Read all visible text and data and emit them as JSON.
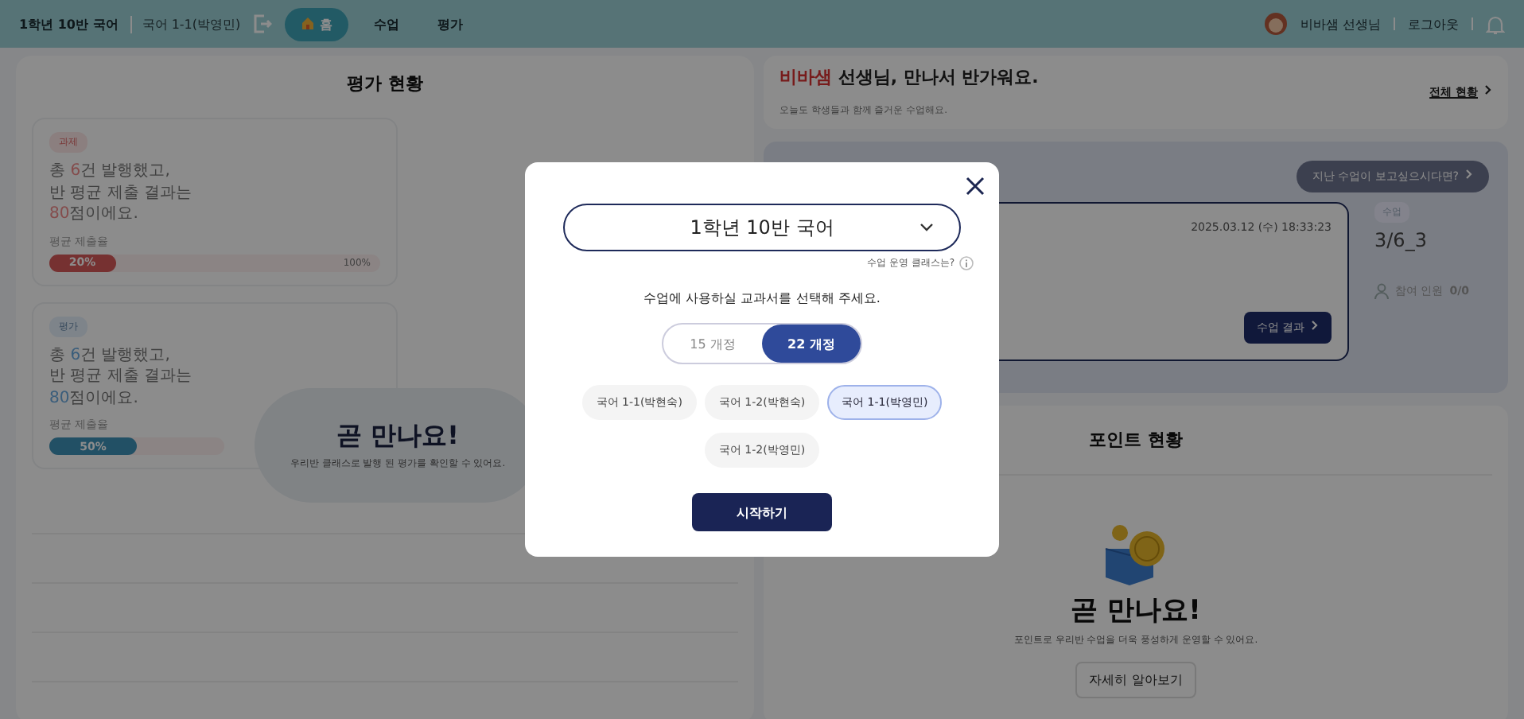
{
  "header": {
    "class_name": "1학년 10반 국어",
    "textbook": "국어 1-1(박영민)",
    "tabs": [
      {
        "label": "홈",
        "selected": true,
        "icon": true
      },
      {
        "label": "수업",
        "selected": false,
        "icon": false
      },
      {
        "label": "평가",
        "selected": false,
        "icon": false
      }
    ],
    "user": "비바샘 선생님",
    "logout": "로그아웃"
  },
  "evaluation": {
    "title": "평가 현황",
    "cards": [
      {
        "kind": "assignment",
        "tag": "과제",
        "summary": [
          {
            "text": "총 ",
            "highlight": false
          },
          {
            "text": "6",
            "highlight": true
          },
          {
            "text": "건 발행했고,\n반 평균 제출 결과는\n",
            "highlight": false
          },
          {
            "text": "80",
            "highlight": true
          },
          {
            "text": "점이에요.",
            "highlight": false
          }
        ],
        "rate_label": "평균 제출율",
        "level": 0.2,
        "reading": "20%",
        "max": "100%"
      },
      {
        "kind": "test",
        "tag": "평가",
        "summary": [
          {
            "text": "총 ",
            "highlight": false
          },
          {
            "text": "6",
            "highlight": true
          },
          {
            "text": "건 발행했고,\n반 평균 제출 결과는\n",
            "highlight": false
          },
          {
            "text": "80",
            "highlight": true
          },
          {
            "text": "점이에요.",
            "highlight": false
          }
        ],
        "rate_label": "평균 제출율",
        "level": 0.5,
        "reading": "50%"
      }
    ],
    "soon_title": "곧 만나요!",
    "soon_text": "우리반 클래스로 발행 된 평가를 확인할 수 있어요."
  },
  "greeting": {
    "parts": [
      {
        "text": "비바샘",
        "highlight": true
      },
      {
        "text": " 선생님, 만나서 반가워요.",
        "highlight": false
      }
    ],
    "subtitle": "오늘도 학생들과 함께 즐거운 수업해요.",
    "link": "전체 현황"
  },
  "lesson": {
    "past_button": "지난 수업이 보고싶으시다면?",
    "datetime": "2025.03.12 (수) 18:33:23",
    "result_button": "수업 결과",
    "tag": "수업",
    "code": "3/6_3",
    "participants_label": "참여 인원",
    "participants": "0/0"
  },
  "points": {
    "title": "포인트 현황",
    "soon_title": "곧 만나요!",
    "soon_text": "포인트로 우리반 수업을 더욱 풍성하게 운영할 수 있어요.",
    "button": "자세히 알아보기"
  },
  "modal": {
    "class_select": "1학년 10반 국어",
    "help": "수업 운영 클래스는?",
    "prompt": "수업에 사용하실 교과서를 선택해 주세요.",
    "curricula": [
      {
        "label": "15 개정",
        "selected": false
      },
      {
        "label": "22 개정",
        "selected": true
      }
    ],
    "textbooks": [
      {
        "label": "국어 1-1(박현숙)",
        "selected": false
      },
      {
        "label": "국어 1-2(박현숙)",
        "selected": false
      },
      {
        "label": "국어 1-1(박영민)",
        "selected": true
      },
      {
        "label": "국어 1-2(박영민)",
        "selected": false
      }
    ],
    "start": "시작하기"
  }
}
